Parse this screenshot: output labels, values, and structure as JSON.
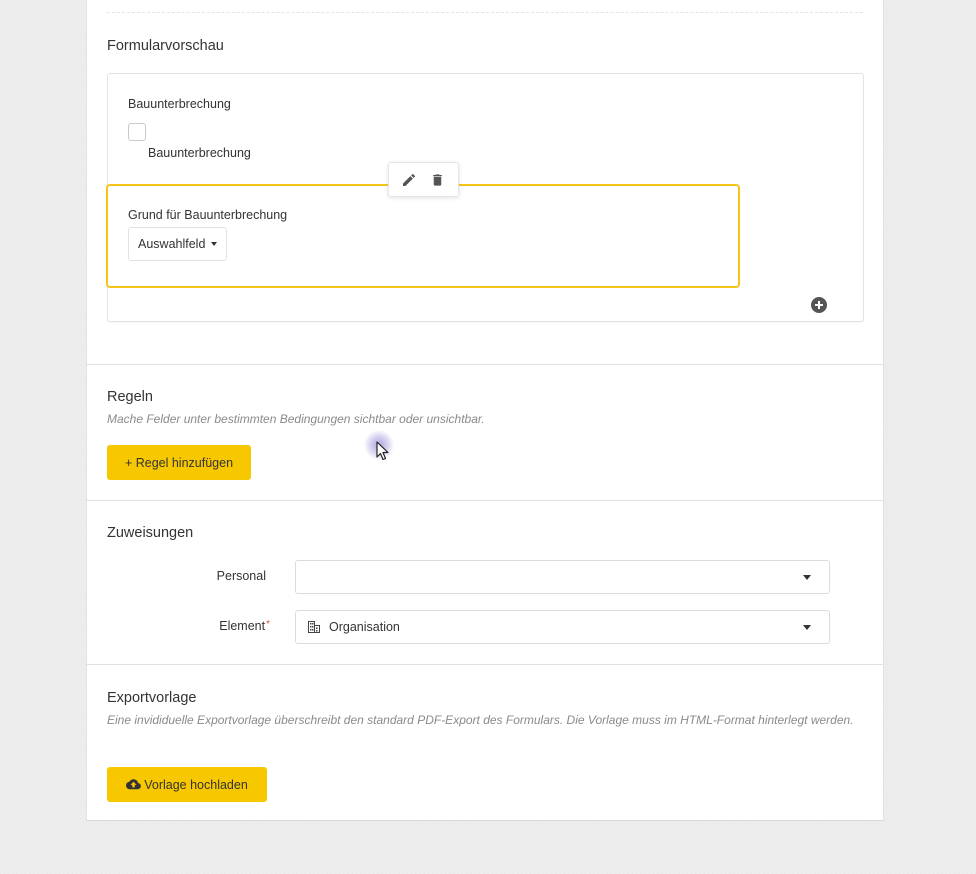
{
  "preview": {
    "title": "Formularvorschau",
    "checkbox_field": {
      "label": "Bauunterbrechung",
      "option_label": "Bauunterbrechung"
    },
    "select_field": {
      "label": "Grund für Bauunterbrechung",
      "button_label": "Auswahlfeld"
    },
    "toolbar": {
      "edit_icon": "pencil-icon",
      "delete_icon": "trash-icon"
    },
    "add_icon": "plus-circle-icon"
  },
  "rules": {
    "title": "Regeln",
    "subtitle": "Mache Felder unter bestimmten Bedingungen sichtbar oder unsichtbar.",
    "add_button": "+ Regel hinzufügen"
  },
  "assignments": {
    "title": "Zuweisungen",
    "personal_label": "Personal",
    "personal_value": "",
    "element_label": "Element",
    "element_required_marker": "*",
    "element_value": "Organisation",
    "element_icon": "building-icon"
  },
  "export": {
    "title": "Exportvorlage",
    "subtitle": "Eine invididuelle Exportvorlage überschreibt den standard PDF-Export des Formulars. Die Vorlage muss im HTML-Format hinterlegt werden.",
    "upload_button": "Vorlage hochladen",
    "upload_icon": "cloud-upload-icon"
  },
  "colors": {
    "accent": "#f7c800",
    "selected_border": "#f5c518",
    "required": "#d9534f"
  }
}
